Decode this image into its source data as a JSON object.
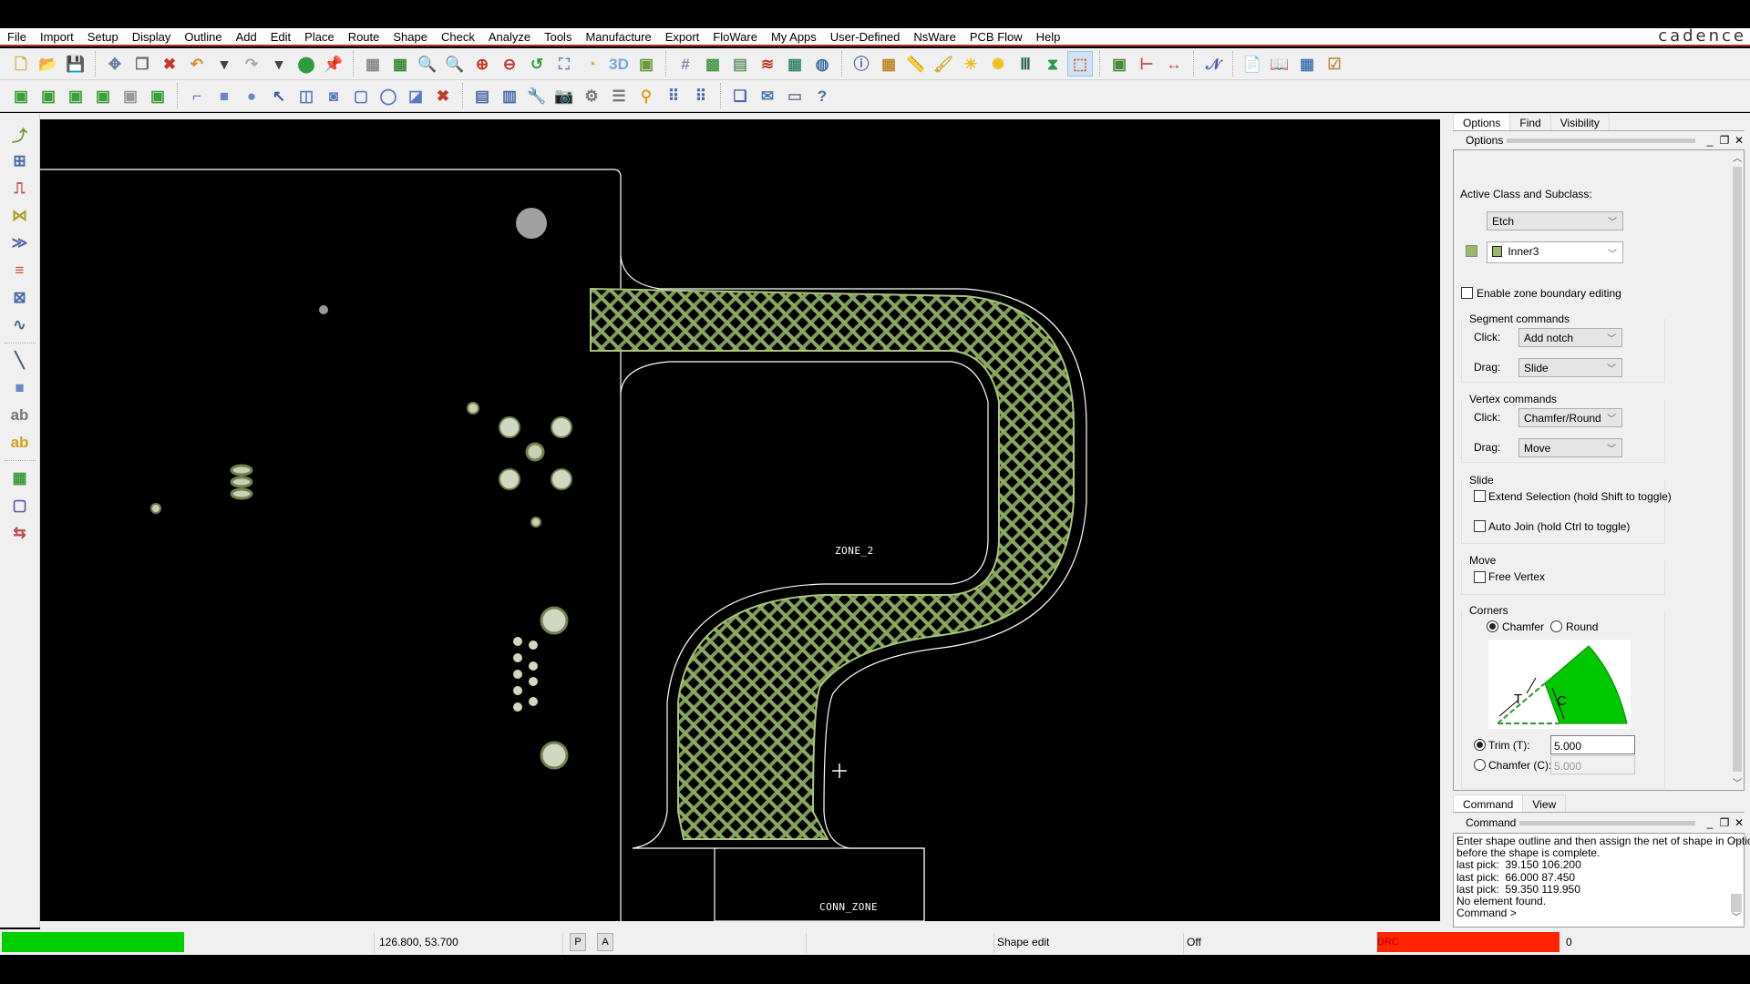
{
  "app": {
    "brand": "cadence"
  },
  "menu": [
    "File",
    "Import",
    "Setup",
    "Display",
    "Outline",
    "Add",
    "Edit",
    "Place",
    "Route",
    "Shape",
    "Check",
    "Analyze",
    "Tools",
    "Manufacture",
    "Export",
    "FloWare",
    "My Apps",
    "User-Defined",
    "NsWare",
    "PCB Flow",
    "Help"
  ],
  "toolbar1": [
    {
      "icon": "new-file-icon",
      "glyph": "🗋",
      "color": "#d8a83a"
    },
    {
      "icon": "open-folder-icon",
      "glyph": "📂",
      "color": "#e2b54a"
    },
    {
      "icon": "save-icon",
      "glyph": "💾",
      "color": "#5a73a8"
    },
    {
      "sep": true
    },
    {
      "icon": "move-icon",
      "glyph": "✥",
      "color": "#6b7fa6"
    },
    {
      "icon": "copy-icon",
      "glyph": "❐",
      "color": "#666"
    },
    {
      "icon": "delete-icon",
      "glyph": "✖",
      "color": "#c0392b"
    },
    {
      "icon": "undo-icon",
      "glyph": "↶",
      "color": "#e08a1e"
    },
    {
      "icon": "undo-dropdown-icon",
      "glyph": "▾",
      "color": "#444"
    },
    {
      "icon": "redo-icon",
      "glyph": "↷",
      "color": "#aaa"
    },
    {
      "icon": "redo-dropdown-icon",
      "glyph": "▾",
      "color": "#444"
    },
    {
      "icon": "shape-fill-icon",
      "glyph": "⬤",
      "color": "#2e9d3f"
    },
    {
      "icon": "pin-icon",
      "glyph": "📌",
      "color": "#2aa14a"
    },
    {
      "sep": true
    },
    {
      "icon": "unrats-all-icon",
      "glyph": "▦",
      "color": "#8a8a8a"
    },
    {
      "icon": "rats-all-icon",
      "glyph": "▦",
      "color": "#3b8a3b"
    },
    {
      "icon": "zoom-points-icon",
      "glyph": "🔍",
      "color": "#6a8bc0"
    },
    {
      "icon": "zoom-fit-icon",
      "glyph": "🔍",
      "color": "#c05a7a"
    },
    {
      "icon": "zoom-in-icon",
      "glyph": "⊕",
      "color": "#c0392b"
    },
    {
      "icon": "zoom-out-icon",
      "glyph": "⊖",
      "color": "#c0392b"
    },
    {
      "icon": "zoom-previous-icon",
      "glyph": "↺",
      "color": "#2e9d3f"
    },
    {
      "icon": "zoom-world-icon",
      "glyph": "⛶",
      "color": "#6a8bc0"
    },
    {
      "icon": "redraw-icon",
      "glyph": "◔",
      "color": "#e8a23a"
    },
    {
      "icon": "3d-view-icon",
      "glyph": "3D",
      "color": "#7aa6e0"
    },
    {
      "icon": "flip-board-icon",
      "glyph": "▣",
      "color": "#6a9a3a"
    },
    {
      "sep": true
    },
    {
      "icon": "grid-toggle-icon",
      "glyph": "#",
      "color": "#7c8fb0"
    },
    {
      "icon": "color-icon",
      "glyph": "▩",
      "color": "#4a9a4a"
    },
    {
      "icon": "layer-priority-icon",
      "glyph": "▤",
      "color": "#6a9a6a"
    },
    {
      "icon": "shadow-mode-icon",
      "glyph": "≋",
      "color": "#c0392b"
    },
    {
      "icon": "cm-icon",
      "glyph": "▦",
      "color": "#3a8a6a"
    },
    {
      "icon": "global-dynamic-icon",
      "glyph": "◍",
      "color": "#3a70a0"
    },
    {
      "sep": true
    },
    {
      "icon": "info-icon",
      "glyph": "ⓘ",
      "color": "#5a6ea8"
    },
    {
      "icon": "element-info-icon",
      "glyph": "▦",
      "color": "#c08a2a"
    },
    {
      "icon": "measure-icon",
      "glyph": "📏",
      "color": "#d8a83a"
    },
    {
      "icon": "highlight-icon",
      "glyph": "🖌",
      "color": "#d8a83a"
    },
    {
      "icon": "shadow-icon",
      "glyph": "☀",
      "color": "#f0c020"
    },
    {
      "icon": "dehighlight-icon",
      "glyph": "✺",
      "color": "#f0c020"
    },
    {
      "icon": "constraint-manager-icon",
      "glyph": "Ⅲ",
      "color": "#2a6a4a"
    },
    {
      "icon": "hourglass-icon",
      "glyph": "⧗",
      "color": "#2a9a4a"
    },
    {
      "icon": "shape-edit-mode-icon",
      "glyph": "⬚",
      "color": "#d06a2a",
      "active": true
    },
    {
      "sep": true
    },
    {
      "icon": "board-icon",
      "glyph": "▣",
      "color": "#4a8a3a"
    },
    {
      "icon": "dimension-icon",
      "glyph": "⊢",
      "color": "#c04a4a"
    },
    {
      "icon": "dimension-linear-icon",
      "glyph": "↔",
      "color": "#c04a4a"
    },
    {
      "sep": true
    },
    {
      "icon": "waveform-icon",
      "glyph": "𝒩",
      "color": "#4a5ea8"
    },
    {
      "sep": true
    },
    {
      "icon": "report-icon",
      "glyph": "📄",
      "color": "#c08a4a"
    },
    {
      "icon": "report-book-icon",
      "glyph": "📖",
      "color": "#4a7ab0"
    },
    {
      "icon": "report-calc-icon",
      "glyph": "▦",
      "color": "#4a7ab0"
    },
    {
      "icon": "report-check-icon",
      "glyph": "☑",
      "color": "#c08a4a"
    }
  ],
  "toolbar2": [
    {
      "icon": "layer-top-icon",
      "glyph": "▣",
      "color": "#3aa03a"
    },
    {
      "icon": "layer-inner-icon",
      "glyph": "▣",
      "color": "#3aa03a"
    },
    {
      "icon": "layer-inner2-icon",
      "glyph": "▣",
      "color": "#3aa03a"
    },
    {
      "icon": "layer-bottom-icon",
      "glyph": "▣",
      "color": "#3aa03a"
    },
    {
      "icon": "layer-gray-icon",
      "glyph": "▣",
      "color": "#999"
    },
    {
      "icon": "layer-copy-icon",
      "glyph": "▣",
      "color": "#3aa03a"
    },
    {
      "sep": true
    },
    {
      "icon": "shape-corner-icon",
      "glyph": "⌐",
      "color": "#5a7ac0"
    },
    {
      "icon": "shape-rect-icon",
      "glyph": "■",
      "color": "#6a88c8"
    },
    {
      "icon": "shape-circle-icon",
      "glyph": "●",
      "color": "#6a88c8"
    },
    {
      "icon": "select-shape-icon",
      "glyph": "↖",
      "color": "#3a5aa0"
    },
    {
      "icon": "manual-void-icon",
      "glyph": "◫",
      "color": "#5a7ac0"
    },
    {
      "icon": "void-circle-icon",
      "glyph": "◙",
      "color": "#5a7ac0"
    },
    {
      "icon": "edit-boundary-icon",
      "glyph": "▢",
      "color": "#5a7ac0"
    },
    {
      "icon": "delete-islands-icon",
      "glyph": "◯",
      "color": "#5a7ac0"
    },
    {
      "icon": "change-shape-type-icon",
      "glyph": "◪",
      "color": "#5a7ac0"
    },
    {
      "icon": "merge-shapes-icon",
      "glyph": "✖",
      "color": "#c0392b"
    },
    {
      "sep": true
    },
    {
      "icon": "odb-icon",
      "glyph": "▤",
      "color": "#4a6aa8"
    },
    {
      "icon": "library-icon",
      "glyph": "▥",
      "color": "#4a6aa8"
    },
    {
      "icon": "wrench-icon",
      "glyph": "🔧",
      "color": "#777"
    },
    {
      "icon": "camera-icon",
      "glyph": "📷",
      "color": "#666"
    },
    {
      "icon": "refdes-icon",
      "glyph": "⚙",
      "color": "#777"
    },
    {
      "icon": "list-icon",
      "glyph": "☰",
      "color": "#777"
    },
    {
      "icon": "testprep-icon",
      "glyph": "⚲",
      "color": "#e0a020"
    },
    {
      "icon": "pad-array-icon",
      "glyph": "⠿",
      "color": "#4a6aa8"
    },
    {
      "icon": "pad-array2-icon",
      "glyph": "⠿",
      "color": "#4a6aa8"
    },
    {
      "sep": true
    },
    {
      "icon": "window-cascade-icon",
      "glyph": "❏",
      "color": "#4a6aa8"
    },
    {
      "icon": "window-mail-icon",
      "glyph": "✉",
      "color": "#4a7ab0"
    },
    {
      "icon": "window-icon",
      "glyph": "▭",
      "color": "#7a7a9a"
    },
    {
      "icon": "help-icon",
      "glyph": "?",
      "color": "#4a6aa8"
    }
  ],
  "lefttoolbar": [
    {
      "icon": "add-connect-icon",
      "glyph": "⤴",
      "color": "#7a9a3a"
    },
    {
      "icon": "slide-icon",
      "glyph": "⊞",
      "color": "#4a6aa8"
    },
    {
      "icon": "delay-tune-icon",
      "glyph": "⎍",
      "color": "#c04a4a"
    },
    {
      "icon": "add-connect-diff-icon",
      "glyph": "⋈",
      "color": "#b0a020"
    },
    {
      "icon": "fanout-icon",
      "glyph": "≫",
      "color": "#5a6ab0"
    },
    {
      "icon": "bus-route-icon",
      "glyph": "≡",
      "color": "#d0502a"
    },
    {
      "icon": "auto-route-icon",
      "glyph": "⊠",
      "color": "#4a6aa8"
    },
    {
      "icon": "phase-tune-icon",
      "glyph": "∿",
      "color": "#4a6a8a"
    },
    {
      "sep": true
    },
    {
      "icon": "add-line-icon",
      "glyph": "╲",
      "color": "#4a5a7a"
    },
    {
      "icon": "add-rect-icon",
      "glyph": "■",
      "color": "#6a88c8"
    },
    {
      "icon": "add-text-icon",
      "glyph": "ab",
      "color": "#777"
    },
    {
      "icon": "edit-text-icon",
      "glyph": "ab",
      "color": "#d0a020"
    },
    {
      "sep": true
    },
    {
      "icon": "place-manual-icon",
      "glyph": "▦",
      "color": "#3a9a3a"
    },
    {
      "icon": "component-u1-icon",
      "glyph": "▢",
      "color": "#5a5aa0"
    },
    {
      "icon": "swap-icon",
      "glyph": "⇆",
      "color": "#c04a4a"
    }
  ],
  "canvas": {
    "zone2_label": "ZONE_2",
    "conn_zone_label": "CONN_ZONE"
  },
  "panel": {
    "top_tabs": [
      "Options",
      "Find",
      "Visibility"
    ],
    "options_title": "Options",
    "active_class_label": "Active Class and Subclass:",
    "class_value": "Etch",
    "subclass_value": "Inner3",
    "subclass_color": "#9bb86a",
    "enable_zone_label": "Enable zone boundary editing",
    "segment_commands": {
      "title": "Segment commands",
      "click_label": "Click:",
      "click_value": "Add notch",
      "drag_label": "Drag:",
      "drag_value": "Slide"
    },
    "vertex_commands": {
      "title": "Vertex commands",
      "click_label": "Click:",
      "click_value": "Chamfer/Round",
      "drag_label": "Drag:",
      "drag_value": "Move"
    },
    "slide": {
      "title": "Slide",
      "extend_label": "Extend Selection (hold Shift to toggle)",
      "autojoin_label": "Auto Join (hold Ctrl to toggle)"
    },
    "move": {
      "title": "Move",
      "free_vertex_label": "Free Vertex"
    },
    "corners": {
      "title": "Corners",
      "chamfer_label": "Chamfer",
      "round_label": "Round",
      "selected": "Chamfer",
      "diagram_t": "T",
      "diagram_c": "C",
      "trim_label": "Trim (T):",
      "trim_value": "5.000",
      "chamfer_field_label": "Chamfer (C):",
      "chamfer_value": "5.000",
      "selected_mode": "Trim"
    },
    "bottom_tabs": [
      "Command",
      "View"
    ],
    "command_title": "Command",
    "command_lines": [
      "Enter shape outline and then assign the net of shape in Options",
      "before the shape is complete.",
      "last pick:  39.150 106.200",
      "last pick:  66.000 87.450",
      "last pick:  59.350 119.950",
      "No element found.",
      "Command >"
    ]
  },
  "status": {
    "coords": "126.800, 53.700",
    "p_button": "P",
    "a_button": "A",
    "mode": "Shape edit",
    "state": "Off",
    "drc_label": "DRC",
    "drc_count": "0",
    "idle_color": "#00d000",
    "drc_color": "#ff2400"
  }
}
